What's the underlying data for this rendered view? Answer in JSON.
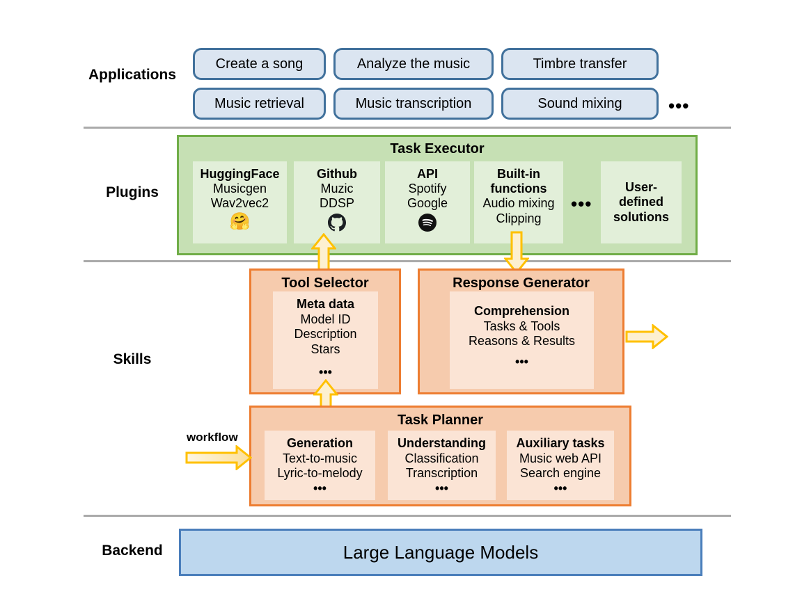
{
  "rows": {
    "applications": "Applications",
    "plugins": "Plugins",
    "skills": "Skills",
    "backend": "Backend"
  },
  "colors": {
    "app_border": "#41719c",
    "app_fill": "#dbe5f1",
    "plugin_border": "#70ad47",
    "plugin_fill": "#c6e0b4",
    "plugin_inner_fill": "#e2efd9",
    "skill_border": "#ed7d31",
    "skill_fill": "#f6cbad",
    "skill_inner_fill": "#fbe4d5",
    "backend_border": "#4a7ebb",
    "backend_fill": "#bdd7ee",
    "arrow_border": "#ffc000",
    "arrow_fill": "#fdf0d0",
    "divider": "#aaaaaa"
  },
  "applications": {
    "row1": [
      "Create a song",
      "Analyze the music",
      "Timbre transfer"
    ],
    "row2": [
      "Music retrieval",
      "Music transcription",
      "Sound mixing"
    ],
    "ellipsis": "•••"
  },
  "plugins": {
    "title": "Task Executor",
    "ellipsis": "•••",
    "boxes": [
      {
        "name": "HuggingFace",
        "items": [
          "Musicgen",
          "Wav2vec2"
        ],
        "icon": "huggingface-icon",
        "icon_glyph": "🤗"
      },
      {
        "name": "Github",
        "items": [
          "Muzic",
          "DDSP"
        ],
        "icon": "github-icon",
        "icon_glyph": ""
      },
      {
        "name": "API",
        "items": [
          "Spotify",
          "Google"
        ],
        "icon": "spotify-icon",
        "icon_glyph": ""
      },
      {
        "name": "Built-in\nfunctions",
        "name_line1": "Built-in",
        "name_line2": "functions",
        "items": [
          "Audio mixing",
          "Clipping"
        ],
        "icon": "",
        "icon_glyph": ""
      },
      {
        "name": "User-defined solutions",
        "name_line1": "User-",
        "name_line2": "defined",
        "name_line3": "solutions",
        "items": [],
        "icon": "",
        "icon_glyph": ""
      }
    ]
  },
  "skills": {
    "tool_selector": {
      "title": "Tool Selector",
      "inner_title": "Meta data",
      "items": [
        "Model ID",
        "Description",
        "Stars"
      ],
      "ellipsis": "•••"
    },
    "response_generator": {
      "title": "Response Generator",
      "inner_title": "Comprehension",
      "items": [
        "Tasks & Tools",
        "Reasons & Results"
      ],
      "ellipsis": "•••"
    },
    "task_planner": {
      "title": "Task Planner",
      "groups": [
        {
          "name": "Generation",
          "items": [
            "Text-to-music",
            "Lyric-to-melody"
          ],
          "ellipsis": "•••"
        },
        {
          "name": "Understanding",
          "items": [
            "Classification",
            "Transcription"
          ],
          "ellipsis": "•••"
        },
        {
          "name": "Auxiliary tasks",
          "items": [
            "Music web API",
            "Search engine"
          ],
          "ellipsis": "•••"
        }
      ]
    },
    "workflow_label": "workflow"
  },
  "backend": {
    "label": "Large Language Models"
  }
}
